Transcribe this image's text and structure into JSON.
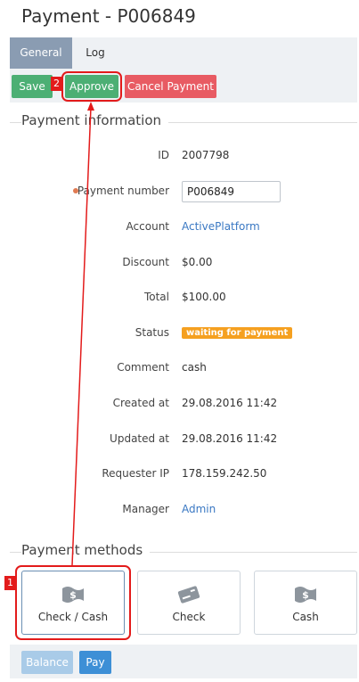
{
  "page": {
    "title": "Payment - P006849"
  },
  "tabs": [
    {
      "label": "General",
      "active": true
    },
    {
      "label": "Log",
      "active": false
    }
  ],
  "toolbar": {
    "save_label": "Save",
    "approve_label": "Approve",
    "cancel_label": "Cancel Payment"
  },
  "info": {
    "section_title": "Payment information",
    "id_label": "ID",
    "id_value": "2007798",
    "number_label": "Payment number",
    "number_value": "P006849",
    "account_label": "Account",
    "account_value": "ActivePlatform",
    "discount_label": "Discount",
    "discount_value": "$0.00",
    "total_label": "Total",
    "total_value": "$100.00",
    "status_label": "Status",
    "status_value": "waiting for payment",
    "comment_label": "Comment",
    "comment_value": "cash",
    "created_label": "Created at",
    "created_value": "29.08.2016 11:42",
    "updated_label": "Updated at",
    "updated_value": "29.08.2016 11:42",
    "ip_label": "Requester IP",
    "ip_value": "178.159.242.50",
    "manager_label": "Manager",
    "manager_value": "Admin"
  },
  "methods": {
    "section_title": "Payment methods",
    "items": [
      {
        "label": "Check / Cash",
        "icon": "money-bill-icon",
        "selected": true
      },
      {
        "label": "Check",
        "icon": "check-card-icon",
        "selected": false
      },
      {
        "label": "Cash",
        "icon": "money-bill-icon",
        "selected": false
      }
    ]
  },
  "bottom": {
    "balance_label": "Balance",
    "pay_label": "Pay"
  },
  "annotations": {
    "marker_1": "1",
    "marker_2": "2"
  },
  "colors": {
    "accent_green": "#4caf74",
    "danger_red": "#e85b63",
    "link_blue": "#3a78c3",
    "status_orange": "#f5a020",
    "annotation_red": "#e31b1b"
  }
}
